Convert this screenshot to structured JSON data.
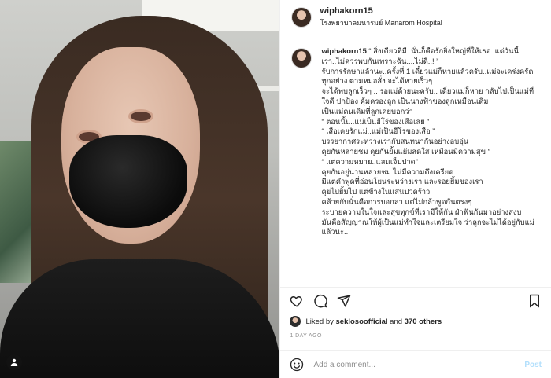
{
  "header": {
    "username": "wiphakorn15",
    "location": "โรงพยาบาลมนารมย์ Manarom Hospital",
    "more_label": "•••"
  },
  "caption": {
    "username": "wiphakorn15",
    "lines": [
      "“ สิ่งเดียวที่มี..นั่นก็คือรักยิ่งใหญ่ที่ให้เธอ..แต่วันนี้เรา..ไม่ควรพบกันเพราะฉัน....ไม่ดี..! ”",
      "",
      "รับการรักษาแล้วนะ..ครั้งที่ 1 เดี๋ยวแม่ก็หายแล้วครับ..แม่จะเคร่งครัดทุกอย่าง ตามหมอสั่ง จะได้หายเร็วๆ..",
      "จะได้พบลูกเร็วๆ .. รอแม่ด้วยนะครับ.. เดี๋ยวแม่ก็หาย กลับไปเป็นแม่ที่ใจดี ปกป้อง คุ้มครองลูก เป็นนางฟ้าของลูกเหมือนเดิม",
      "เป็นแม่คนเดิมที่ลูกเคยบอกว่า",
      "“ ตอนนั้น..แม่เป็นฮีโร่ของเสือเลย ”",
      "“ เสือเคยรักแม่..แม่เป็นฮีโร่ของเสือ ”",
      "บรรยากาศระหว่างเรากับสนทนากันอย่างอบอุ่น",
      "คุยกันหลายชม คุยกันยิ้มแย้มสดใส เหมือนมีความสุข ”",
      "",
      "“ แต่ความหมาย..แสนเจ็บปวด”",
      "",
      "คุยกันอยู่นานหลายชม ไม่มีความตึงเครียด",
      "",
      "มีแต่คำพูดที่อ่อนโยนระหว่างเรา และรอยยิ้มของเรา",
      "คุยไปยิ้มไป แต่ข้างในแสนปวดร้าว",
      "คล้ายกับนั่นคือการบอกลา แต่ไม่กล้าพูดกันตรงๆ",
      "ระบายความในใจและสุขทุกข์ที่เรามีให้กัน ฝ่าฟันกันมาอย่างสงบ",
      "มันคือสัญญาณให้ผู้เป็นแม่ทำใจและเตรียมใจ ว่าลูกจะไม่ได้อยู่กับแม่แล้วนะ.."
    ]
  },
  "likes": {
    "prefix": "Liked by",
    "user": "seklosoofficial",
    "joiner": "and",
    "others": "370 others"
  },
  "time_ago": "1 DAY AGO",
  "comment": {
    "placeholder": "Add a comment...",
    "post_label": "Post"
  },
  "icons": {
    "like": "heart-icon",
    "comment": "comment-icon",
    "share": "share-icon",
    "save": "bookmark-icon",
    "emoji": "emoji-icon",
    "tags": "user-tag-icon"
  },
  "colors": {
    "text": "#262626",
    "muted": "#8e8e8e",
    "post_disabled": "#b2dffc",
    "divider": "#efefef"
  }
}
